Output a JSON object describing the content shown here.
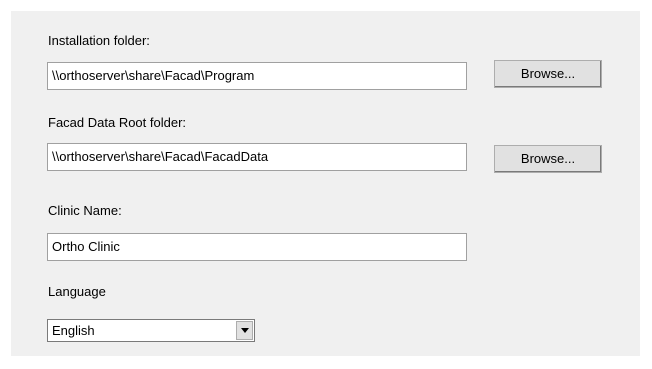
{
  "form": {
    "install_folder_label": "Installation folder:",
    "install_folder_value": "\\\\orthoserver\\share\\Facad\\Program",
    "browse_label_1": "Browse...",
    "data_root_label": "Facad Data Root folder:",
    "data_root_value": "\\\\orthoserver\\share\\Facad\\FacadData",
    "browse_label_2": "Browse...",
    "clinic_name_label": "Clinic Name:",
    "clinic_name_value": "Ortho Clinic",
    "language_label": "Language",
    "language_selected": "English",
    "language_dropdown_icon": "chevron-down-icon"
  }
}
